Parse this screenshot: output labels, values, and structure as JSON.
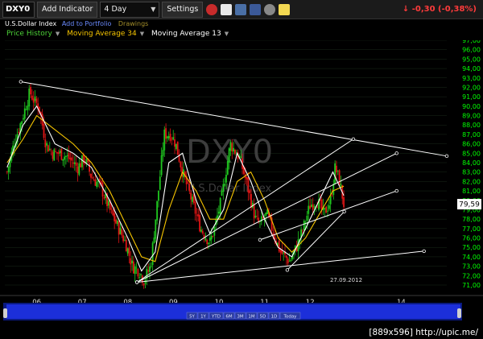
{
  "toolbar": {
    "ticker": "DXY0",
    "add_indicator": "Add Indicator",
    "period": "4 Day",
    "settings": "Settings",
    "quote_change": "↓ -0,30 (-0,38%)",
    "icons": [
      "clock-icon",
      "page-icon",
      "people-icon",
      "facebook-icon",
      "gear-icon",
      "note-icon"
    ]
  },
  "infobar": {
    "name": "U.S.Dollar Index",
    "add_portfolio": "Add to Portfolio",
    "drawings": "Drawings"
  },
  "legend": {
    "price_history": "Price History",
    "ma34": "Moving Average 34",
    "ma13": "Moving Average 13"
  },
  "colors": {
    "price_history": "#4cd137",
    "ma34": "#f5c400",
    "ma13": "#ffffff",
    "up_candle": "#1fc81f",
    "down_candle": "#e01515",
    "trendline": "#ffffff",
    "axis": "#00ff00",
    "grid": "#1a2a1a",
    "watermark": "#555555",
    "navigator": "#1c2fd9",
    "last_price_tag": "#ffffff"
  },
  "watermark": {
    "ticker": "DXY0",
    "name": "U.S.Dollar Index"
  },
  "footer_tag": "[889x596] http://upic.me/",
  "chart_data": {
    "type": "line",
    "ylim": [
      71,
      97
    ],
    "xlim": [
      2005.3,
      2015.0
    ],
    "x_ticks": [
      "06",
      "07",
      "08",
      "09",
      "10",
      "11",
      "12",
      "14"
    ],
    "x_tick_positions": [
      2006,
      2007,
      2008,
      2009,
      2010,
      2011,
      2012,
      2014
    ],
    "y_ticks": [
      "71,00",
      "72,00",
      "73,00",
      "74,00",
      "75,00",
      "76,00",
      "77,00",
      "78,00",
      "79,00",
      "80,00",
      "81,00",
      "82,00",
      "83,00",
      "84,00",
      "85,00",
      "86,00",
      "87,00",
      "88,00",
      "89,00",
      "90,00",
      "91,00",
      "92,00",
      "93,00",
      "94,00",
      "95,00",
      "96,00",
      "97,00"
    ],
    "last_price": "79,59",
    "last_price_value": 79.59,
    "date_label": "27.09.2012",
    "series": [
      {
        "name": "Price History",
        "x": [
          2005.35,
          2005.5,
          2005.7,
          2005.85,
          2005.95,
          2006.05,
          2006.2,
          2006.35,
          2006.5,
          2006.7,
          2006.9,
          2007.05,
          2007.2,
          2007.4,
          2007.6,
          2007.8,
          2007.95,
          2008.1,
          2008.25,
          2008.35,
          2008.5,
          2008.65,
          2008.8,
          2008.95,
          2009.05,
          2009.2,
          2009.4,
          2009.6,
          2009.8,
          2009.9,
          2010.05,
          2010.25,
          2010.45,
          2010.6,
          2010.8,
          2010.9,
          2011.05,
          2011.2,
          2011.35,
          2011.55,
          2011.7,
          2011.85,
          2012.0,
          2012.15,
          2012.3,
          2012.45,
          2012.55,
          2012.65,
          2012.74
        ],
        "y": [
          83,
          86,
          89,
          91.5,
          90.5,
          90,
          86,
          85,
          85,
          84.5,
          83.5,
          84.5,
          82.5,
          81.5,
          79,
          77,
          75.5,
          73,
          72.5,
          71.5,
          73,
          80,
          87,
          87,
          86,
          83,
          80,
          77,
          75.5,
          77,
          80,
          86,
          84.5,
          82,
          78,
          77.5,
          78.5,
          76.5,
          74.5,
          73.5,
          75,
          77,
          79.5,
          80,
          78.5,
          80,
          83.5,
          82,
          79.6
        ]
      },
      {
        "name": "Moving Average 34",
        "x": [
          2005.35,
          2005.7,
          2006.0,
          2006.4,
          2006.8,
          2007.2,
          2007.6,
          2008.0,
          2008.3,
          2008.6,
          2008.9,
          2009.2,
          2009.5,
          2009.8,
          2010.1,
          2010.4,
          2010.7,
          2011.0,
          2011.3,
          2011.6,
          2011.9,
          2012.2,
          2012.5,
          2012.74
        ],
        "y": [
          84,
          86.5,
          89,
          87.5,
          86,
          84,
          81,
          77,
          74,
          73.5,
          79,
          83,
          81,
          78,
          78,
          82,
          83,
          80,
          76,
          74.5,
          76,
          78.5,
          81,
          81.5
        ]
      },
      {
        "name": "Moving Average 13",
        "x": [
          2005.35,
          2005.7,
          2006.0,
          2006.4,
          2006.8,
          2007.2,
          2007.6,
          2008.0,
          2008.3,
          2008.6,
          2008.9,
          2009.2,
          2009.5,
          2009.8,
          2010.1,
          2010.4,
          2010.7,
          2011.0,
          2011.3,
          2011.6,
          2011.9,
          2012.2,
          2012.5,
          2012.74
        ],
        "y": [
          83.5,
          88,
          90,
          86,
          85,
          83.5,
          80,
          76,
          72.5,
          74.5,
          84,
          85,
          80,
          76.5,
          79,
          85,
          82,
          78,
          75,
          74,
          77,
          80,
          83,
          80.5
        ]
      }
    ],
    "trendlines": [
      {
        "x": [
          2005.65,
          2015.0
        ],
        "y": [
          92.6,
          84.7
        ]
      },
      {
        "x": [
          2008.2,
          2012.95
        ],
        "y": [
          71.3,
          86.5
        ]
      },
      {
        "x": [
          2008.2,
          2013.9
        ],
        "y": [
          71.3,
          85.0
        ]
      },
      {
        "x": [
          2010.9,
          2013.9
        ],
        "y": [
          75.8,
          81.0
        ]
      },
      {
        "x": [
          2008.2,
          2014.5
        ],
        "y": [
          71.3,
          74.6
        ]
      },
      {
        "x": [
          2011.5,
          2012.75
        ],
        "y": [
          72.6,
          78.8
        ]
      }
    ],
    "navigator_labels": [
      "5Y",
      "1Y",
      "YTD",
      "6M",
      "3M",
      "1M",
      "5D",
      "1D",
      "Today"
    ]
  }
}
